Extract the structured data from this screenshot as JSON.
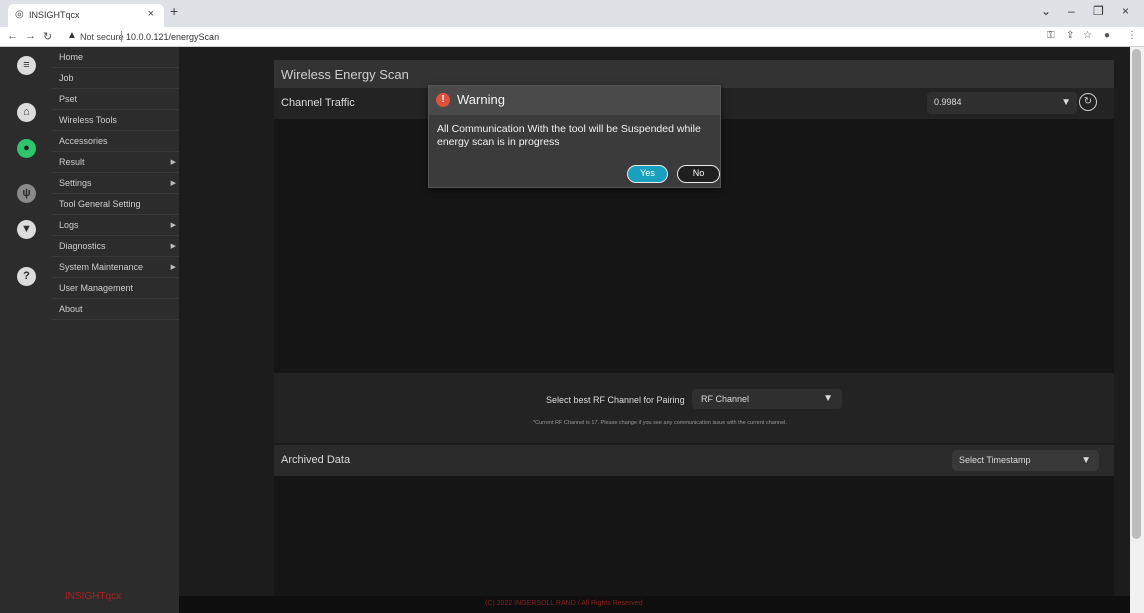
{
  "browser": {
    "tab_title": "INSIGHTqcx",
    "tab_close": "×",
    "new_tab": "+",
    "not_secure": "Not secure",
    "url": "10.0.0.121/energyScan",
    "window_controls": [
      "⌄",
      "–",
      "❐",
      "×"
    ]
  },
  "sidebar": {
    "icons": [
      "menu-icon",
      "home-icon",
      "user-icon",
      "usb-icon",
      "chevron-down-icon",
      "help-icon"
    ],
    "items": [
      {
        "label": "Home",
        "arrow": false
      },
      {
        "label": "Job",
        "arrow": false
      },
      {
        "label": "Pset",
        "arrow": false
      },
      {
        "label": "Wireless Tools",
        "arrow": false
      },
      {
        "label": "Accessories",
        "arrow": false
      },
      {
        "label": "Result",
        "arrow": true
      },
      {
        "label": "Settings",
        "arrow": true
      },
      {
        "label": "Tool General Setting",
        "arrow": false
      },
      {
        "label": "Logs",
        "arrow": true
      },
      {
        "label": "Diagnostics",
        "arrow": true
      },
      {
        "label": "System Maintenance",
        "arrow": true
      },
      {
        "label": "User Management",
        "arrow": false
      },
      {
        "label": "About",
        "arrow": false
      }
    ],
    "brand": "INSIGHTqcx"
  },
  "main": {
    "title": "Wireless Energy Scan",
    "channel_traffic": "Channel Traffic",
    "value_select": "0.9984",
    "pairing_label": "Select best RF Channel for Pairing",
    "rf_select_placeholder": "RF Channel",
    "rf_note": "*Current RF Channel is 17. Please change if you see any communication issue with the current channel.",
    "archived_data": "Archived Data",
    "timestamp_select": "Select Timestamp"
  },
  "dialog": {
    "title": "Warning",
    "message": "All Communication With the tool will be Suspended while energy scan is in progress",
    "yes": "Yes",
    "no": "No"
  },
  "footer": {
    "copyright": "(C) 2022 INGERSOLL RAND / All Rights Reserved"
  }
}
